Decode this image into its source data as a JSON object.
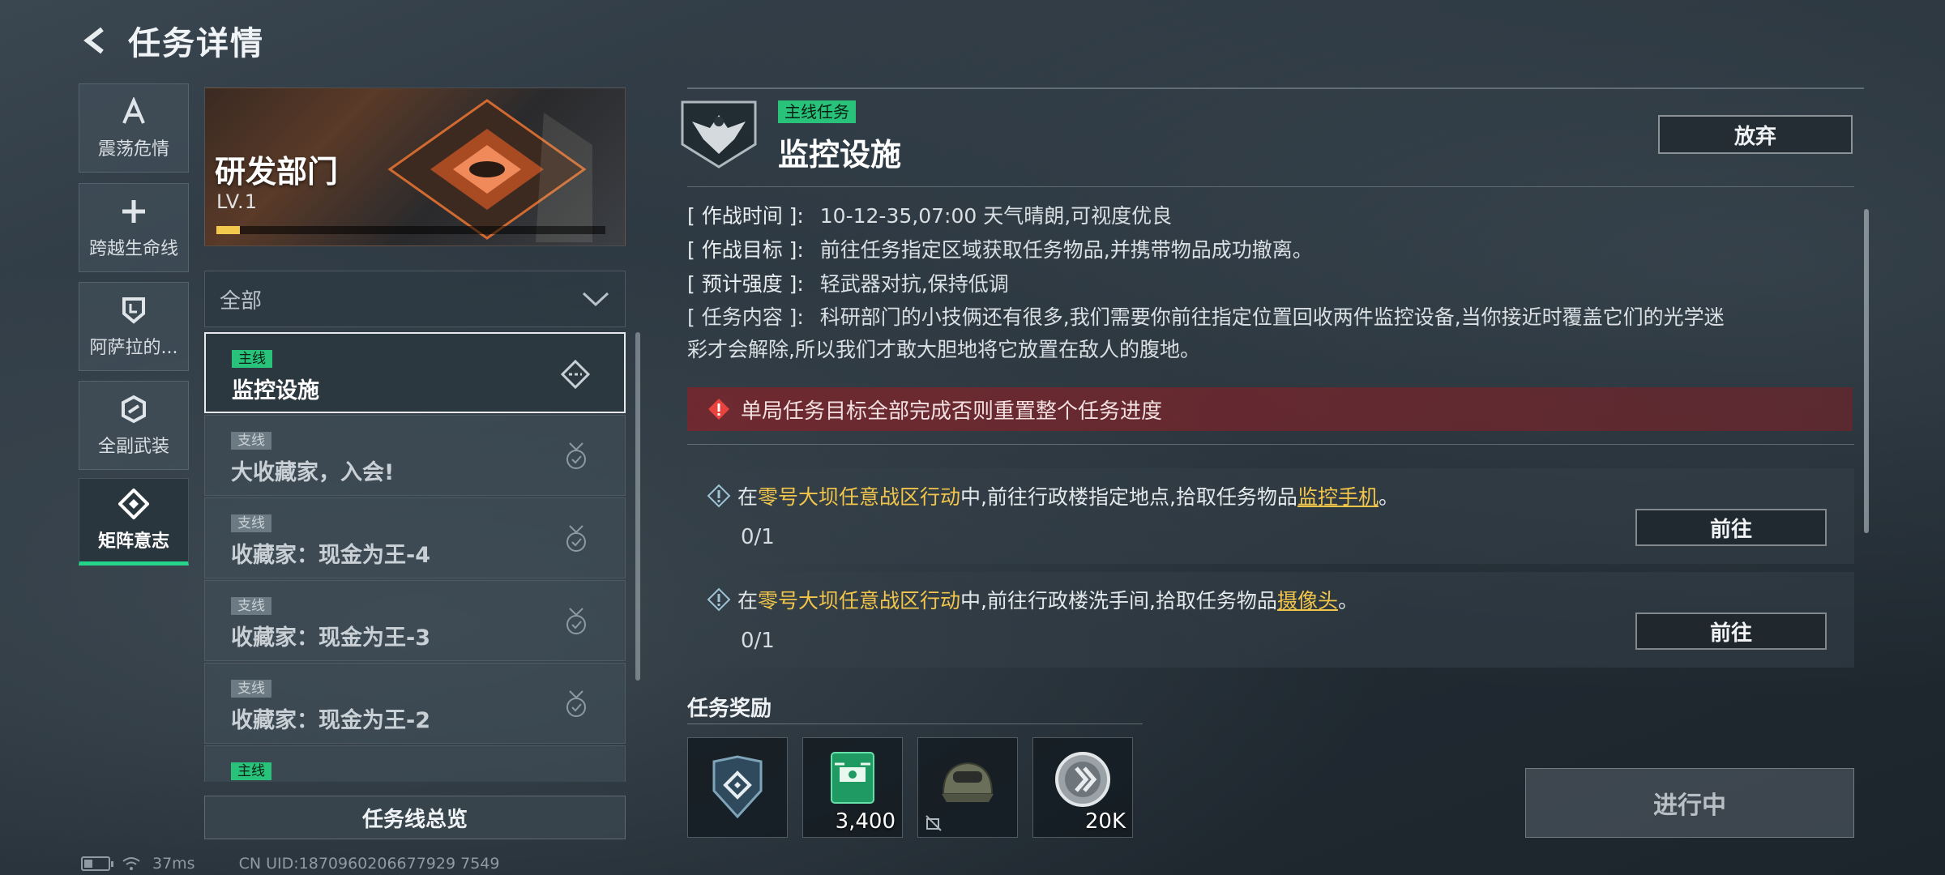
{
  "header": {
    "title": "任务详情"
  },
  "categories": [
    {
      "label": "震荡危情",
      "icon": "letter-a-icon"
    },
    {
      "label": "跨越生命线",
      "icon": "plus-cross-icon"
    },
    {
      "label": "阿萨拉的...",
      "icon": "shield-badge-icon"
    },
    {
      "label": "全副武装",
      "icon": "hexagon-mark-icon"
    },
    {
      "label": "矩阵意志",
      "icon": "matrix-diamond-icon",
      "active": true
    }
  ],
  "department": {
    "name": "研发部门",
    "level": "LV.1",
    "progress": 0.06
  },
  "filter": {
    "value": "全部"
  },
  "task_list": [
    {
      "tag": "主线",
      "title": "监控设施",
      "type": "main",
      "selected": true
    },
    {
      "tag": "支线",
      "title": "大收藏家，入会!",
      "type": "side"
    },
    {
      "tag": "支线",
      "title": "收藏家：现金为王-4",
      "type": "side"
    },
    {
      "tag": "支线",
      "title": "收藏家：现金为王-3",
      "type": "side"
    },
    {
      "tag": "支线",
      "title": "收藏家：现金为王-2",
      "type": "side"
    },
    {
      "tag": "主线",
      "title": "",
      "type": "main"
    }
  ],
  "overview_button": "任务线总览",
  "status_bar": {
    "ping": "37ms",
    "uid": "CN UID:1870960206677929 7549"
  },
  "mission": {
    "tag": "主线任务",
    "title": "监控设施",
    "abandon": "放弃",
    "info": [
      {
        "label": "[ 作战时间 ]:",
        "value": "10-12-35,07:00 天气晴朗,可视度优良"
      },
      {
        "label": "[ 作战目标 ]:",
        "value": "前往任务指定区域获取任务物品,并携带物品成功撤离。"
      },
      {
        "label": "[ 预计强度 ]:",
        "value": "轻武器对抗,保持低调"
      }
    ],
    "content": {
      "label": "[ 任务内容 ]:",
      "line1": "科研部门的小技俩还有很多,我们需要你前往指定位置回收两件监控设备,当你接近时覆盖它们的光学迷",
      "line2": "彩才会解除,所以我们才敢大胆地将它放置在敌人的腹地。"
    },
    "warning": "单局任务目标全部完成否则重置整个任务进度",
    "objectives": [
      {
        "pre": "在",
        "zone": "零号大坝任意战区行动",
        "mid": "中,前往行政楼指定地点,拾取任务物品",
        "item": "监控手机",
        "post": "。",
        "progress": "0/1",
        "button": "前往"
      },
      {
        "pre": "在",
        "zone": "零号大坝任意战区行动",
        "mid": "中,前往行政楼洗手间,拾取任务物品",
        "item": "摄像头",
        "post": "。",
        "progress": "0/1",
        "button": "前往"
      }
    ],
    "rewards_title": "任务奖励",
    "rewards": [
      {
        "icon": "matrix-shield-emblem-icon",
        "qty": ""
      },
      {
        "icon": "green-drone-card-icon",
        "qty": "3,400"
      },
      {
        "icon": "helmet-icon",
        "qty": ""
      },
      {
        "icon": "silver-coin-icon",
        "qty": "20K"
      }
    ],
    "status_button": "进行中"
  },
  "colors": {
    "accent_green": "#28c27a",
    "highlight_yellow": "#f2c64a",
    "warning_red": "#7a262c"
  }
}
